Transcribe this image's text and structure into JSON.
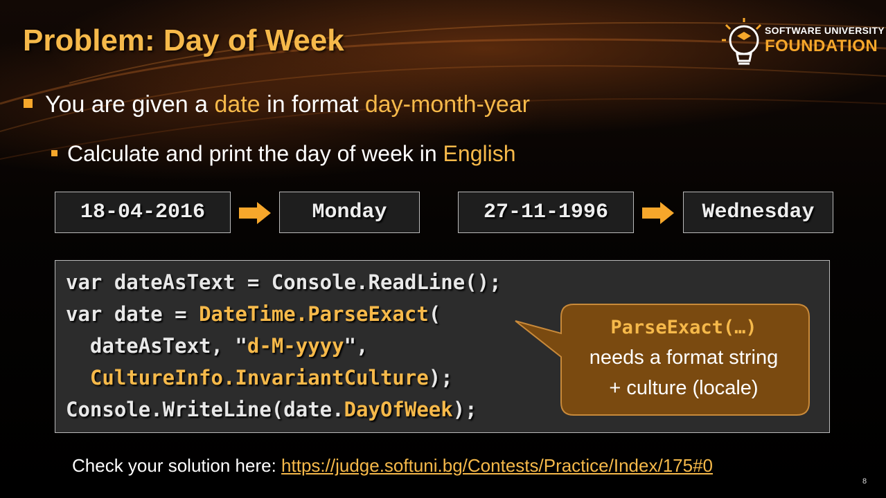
{
  "title": "Problem: Day of Week",
  "logo": {
    "line1": "SOFTWARE UNIVERSITY",
    "line2": "FOUNDATION"
  },
  "bullet1": {
    "t1": "You are given a ",
    "h1": "date",
    "t2": " in format ",
    "h2": "day-month-year"
  },
  "bullet2": {
    "t1": "Calculate and print the day of week in ",
    "h1": "English"
  },
  "examples": [
    {
      "input": "18-04-2016",
      "output": "Monday"
    },
    {
      "input": "27-11-1996",
      "output": "Wednesday"
    }
  ],
  "code": {
    "l1": "var dateAsText = Console.ReadLine();",
    "l2a": "var date = ",
    "l2b": "DateTime.ParseExact",
    "l2c": "(",
    "l3a": "  dateAsText, \"",
    "l3b": "d-M-yyyy",
    "l3c": "\",",
    "l4a": "  ",
    "l4b": "CultureInfo.InvariantCulture",
    "l4c": ");",
    "l5a": "Console.WriteLine(date.",
    "l5b": "DayOfWeek",
    "l5c": ");"
  },
  "callout": {
    "title": "ParseExact(…)",
    "line1": "needs a format string",
    "line2": "+ culture (locale)"
  },
  "footer": {
    "text": "Check your solution here: ",
    "link": "https://judge.softuni.bg/Contests/Practice/Index/175#0"
  },
  "page_number": "8",
  "colors": {
    "accent": "#f6b94a",
    "callout_bg": "#7a4a10"
  }
}
